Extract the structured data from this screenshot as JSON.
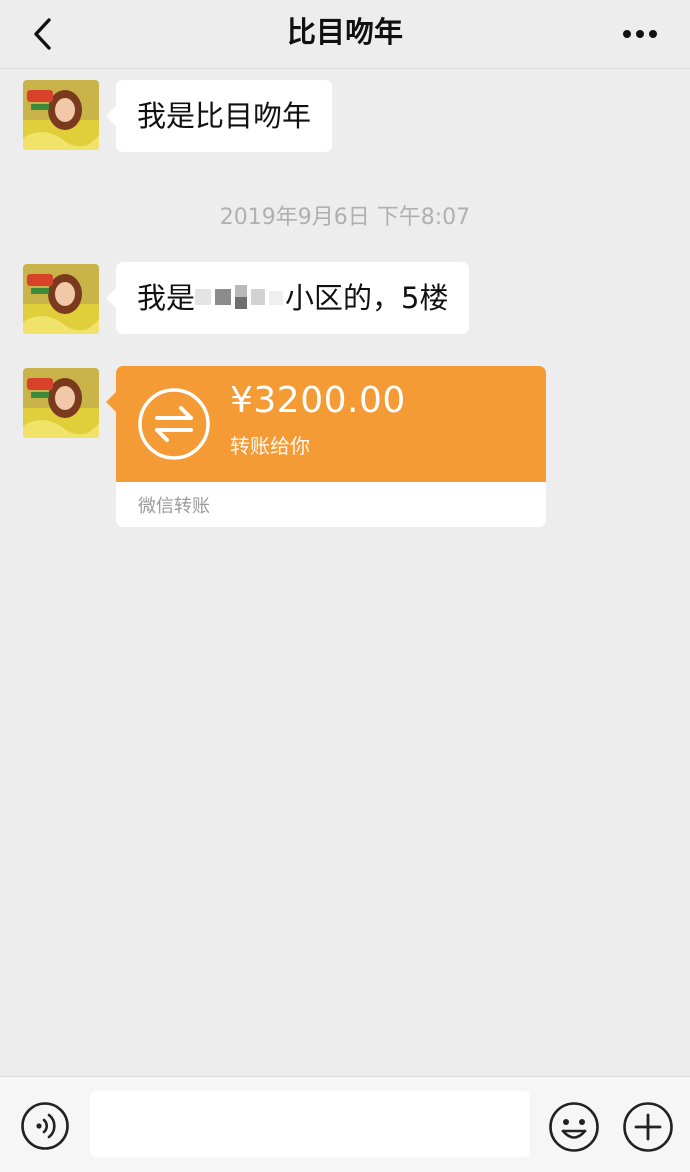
{
  "header": {
    "title": "比目吻年",
    "back_icon": "chevron-left-icon",
    "more_icon": "more-dots-icon"
  },
  "messages": [
    {
      "text": "我是比目吻年"
    },
    {
      "text_before": "我是",
      "text_after": "小区的，5楼"
    }
  ],
  "timestamp": "2019年9月6日 下午8:07",
  "transfer": {
    "amount": "¥3200.00",
    "description": "转账给你",
    "source": "微信转账",
    "icon": "transfer-arrows-icon",
    "color": "#f59b36"
  },
  "input_bar": {
    "voice_icon": "voice-icon",
    "emoji_icon": "emoji-icon",
    "plus_icon": "plus-icon",
    "placeholder": ""
  }
}
